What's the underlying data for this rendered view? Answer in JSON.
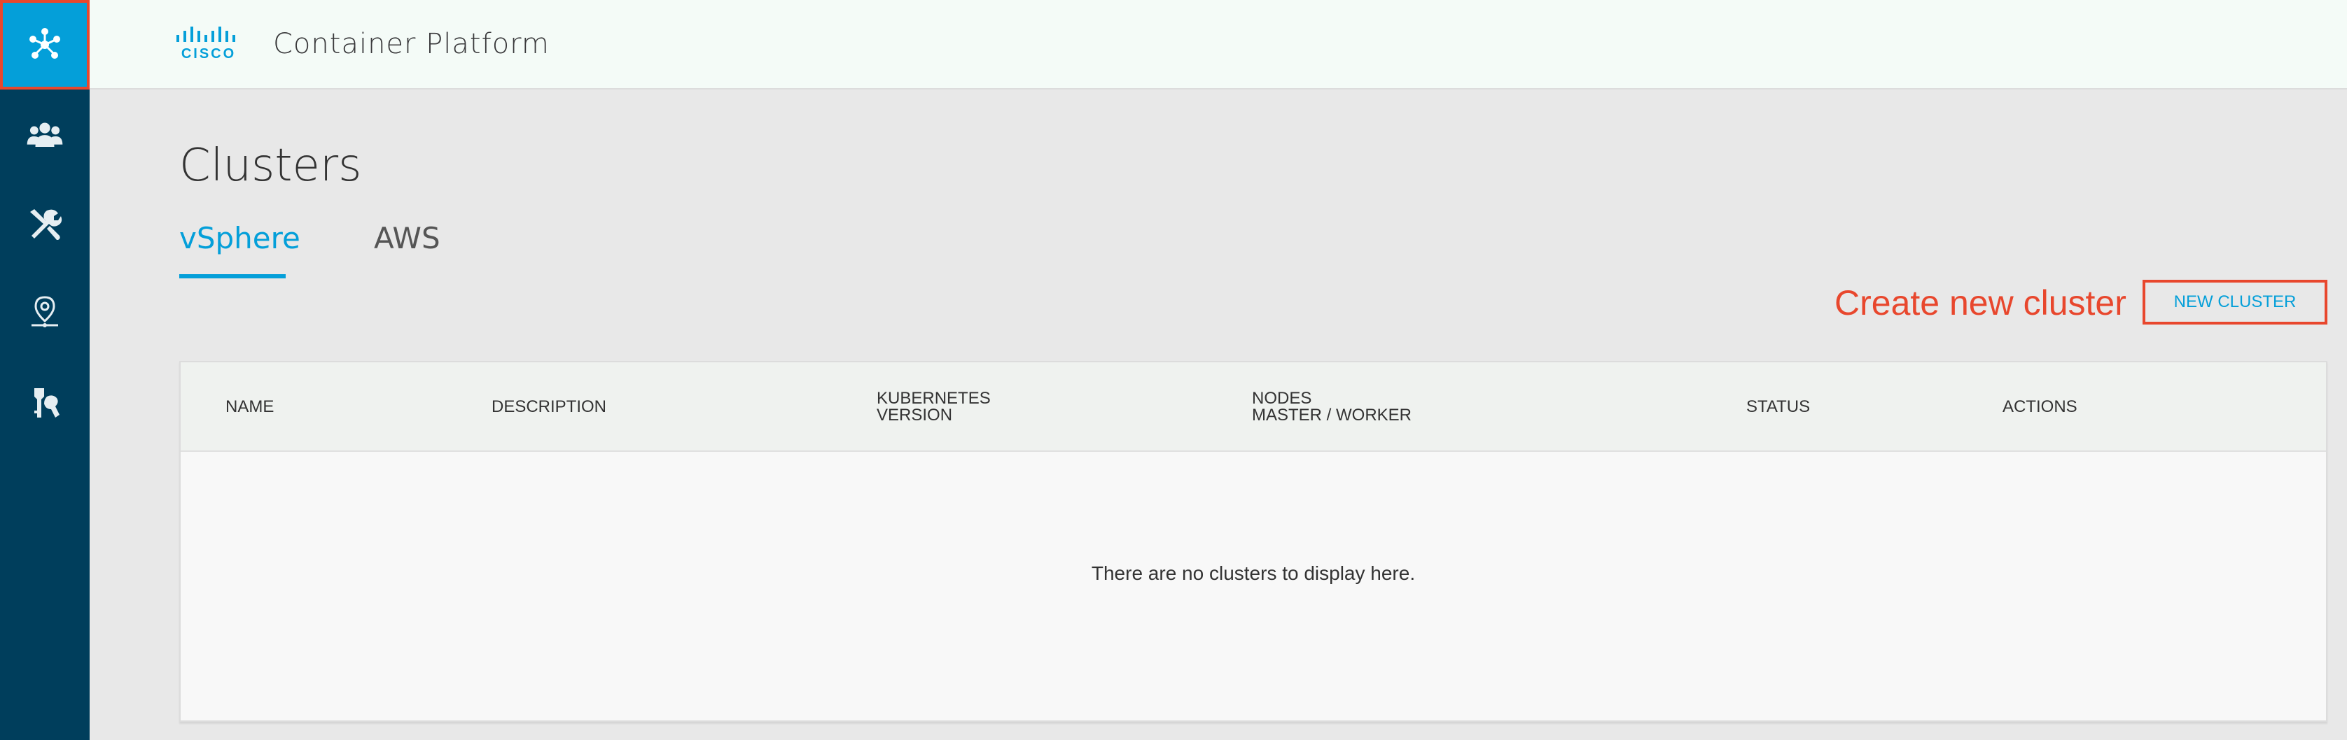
{
  "sidebar": {
    "items": [
      {
        "icon": "cluster-network-icon",
        "active": true
      },
      {
        "icon": "users-icon",
        "active": false
      },
      {
        "icon": "tools-icon",
        "active": false
      },
      {
        "icon": "location-pin-icon",
        "active": false
      },
      {
        "icon": "keys-icon",
        "active": false
      }
    ]
  },
  "header": {
    "logo_text": "CISCO",
    "app_title": "Container Platform"
  },
  "main": {
    "page_title": "Clusters",
    "tabs": [
      {
        "label": "vSphere",
        "active": true
      },
      {
        "label": "AWS",
        "active": false
      }
    ],
    "annotation": "Create new cluster",
    "new_cluster_button": "NEW CLUSTER",
    "table": {
      "columns": [
        "NAME",
        "DESCRIPTION",
        "KUBERNETES\nVERSION",
        "NODES\nMASTER / WORKER",
        "STATUS",
        "ACTIONS"
      ],
      "column_k8s_line1": "KUBERNETES",
      "column_k8s_line2": "VERSION",
      "column_nodes_line1": "NODES",
      "column_nodes_line2": "MASTER / WORKER",
      "empty_message": "There are no clusters to display here."
    }
  },
  "colors": {
    "sidebar_bg": "#003e5c",
    "accent": "#049fd9",
    "annotation_red": "#e8472d",
    "page_bg": "#e8e8e8"
  }
}
